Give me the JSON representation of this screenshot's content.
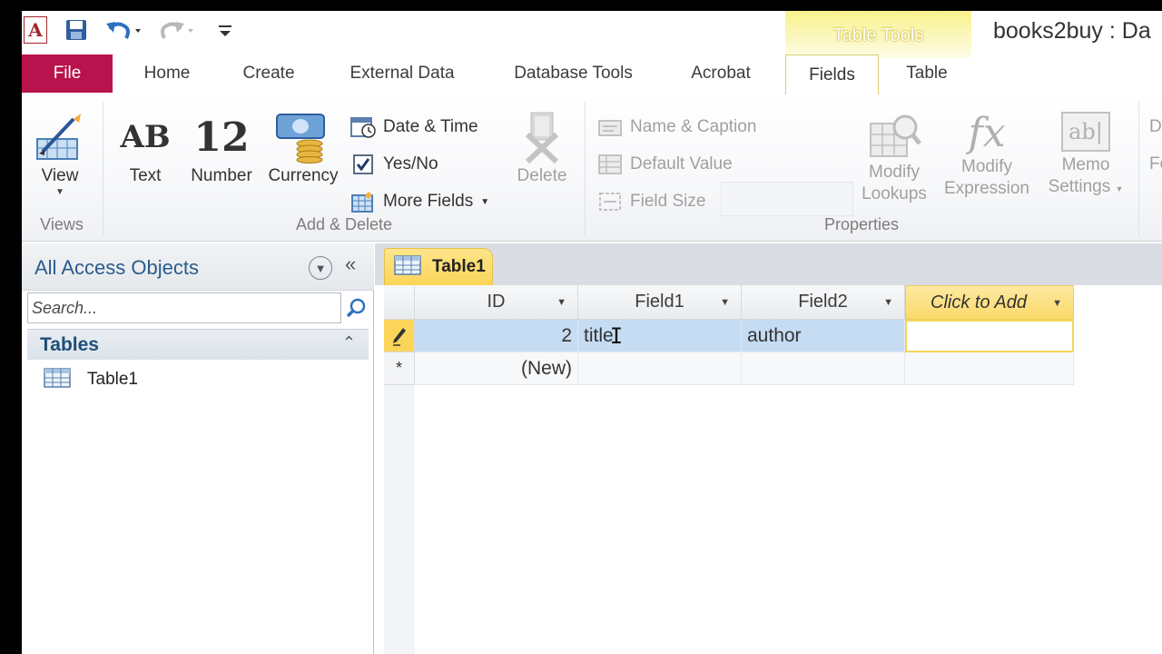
{
  "app": {
    "logo_letter": "A",
    "window_title": "books2buy : Da"
  },
  "quick_access": {
    "save_icon": "save-icon",
    "undo_icon": "undo-icon",
    "redo_icon": "redo-icon",
    "customize_icon": "customize-qa-icon"
  },
  "contextual": {
    "label": "Table Tools"
  },
  "tabs": {
    "file": "File",
    "home": "Home",
    "create": "Create",
    "external_data": "External Data",
    "database_tools": "Database Tools",
    "acrobat": "Acrobat",
    "fields": "Fields",
    "table": "Table"
  },
  "ribbon": {
    "views": {
      "view_label": "View",
      "group_label": "Views"
    },
    "add_delete": {
      "text_icon": "AB",
      "text_label": "Text",
      "number_icon": "12",
      "number_label": "Number",
      "currency_label": "Currency",
      "date_time": "Date & Time",
      "yes_no": "Yes/No",
      "more_fields": "More Fields",
      "delete": "Delete",
      "group_label": "Add & Delete"
    },
    "properties": {
      "name_caption": "Name & Caption",
      "default_value": "Default Value",
      "field_size": "Field Size",
      "modify_lookups_1": "Modify",
      "modify_lookups_2": "Lookups",
      "modify_expression_1": "Modify",
      "modify_expression_2": "Expression",
      "memo_settings_1": "Memo",
      "memo_settings_2": "Settings",
      "fx_icon": "fx",
      "memo_icon": "ab|",
      "group_label": "Properties"
    },
    "cutoff": {
      "top": "D",
      "mid": "Fo"
    }
  },
  "nav_pane": {
    "title": "All Access Objects",
    "search_placeholder": "Search...",
    "section": "Tables",
    "items": [
      {
        "label": "Table1"
      }
    ]
  },
  "document": {
    "tab_label": "Table1",
    "columns": [
      "ID",
      "Field1",
      "Field2",
      "Click to Add"
    ],
    "rows": [
      {
        "id": "2",
        "field1": "title",
        "field2": "author"
      }
    ],
    "new_row_label": "(New)",
    "new_row_marker": "*"
  }
}
